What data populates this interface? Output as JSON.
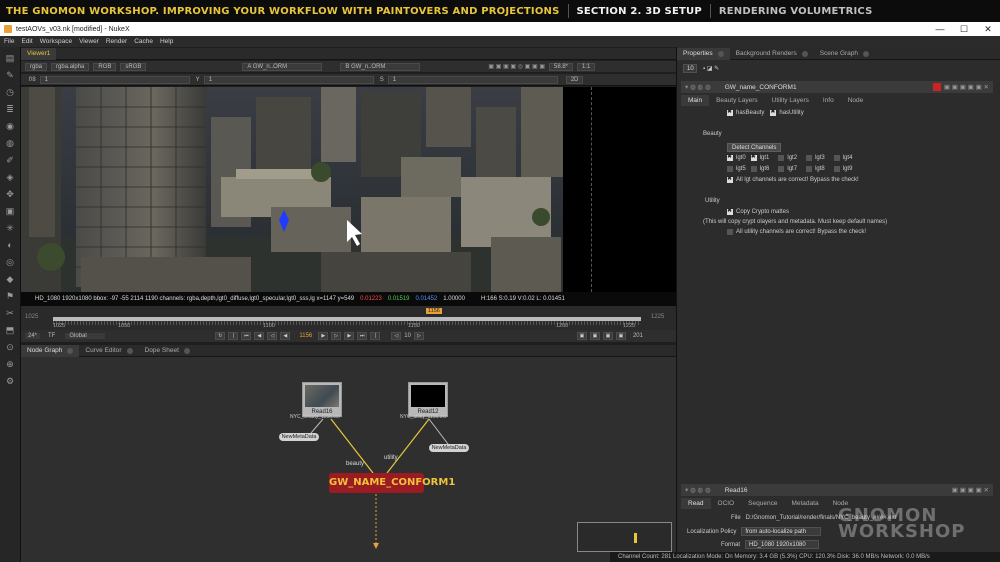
{
  "banner": {
    "part1": "THE GNOMON WORKSHOP. IMPROVING YOUR WORKFLOW WITH PAINTOVERS AND PROJECTIONS",
    "part2": "SECTION 2. 3D SETUP",
    "part3": "RENDERING VOLUMETRICS"
  },
  "window": {
    "title": "testAOVs_v03.nk [modified] - NukeX",
    "minimize": "—",
    "maximize": "☐",
    "close": "✕"
  },
  "menu": [
    "File",
    "Edit",
    "Workspace",
    "Viewer",
    "Render",
    "Cache",
    "Help"
  ],
  "viewer": {
    "tab": "Viewer1",
    "channels": "rgba",
    "alpha": "rgba.alpha",
    "colorspace_rgb": "RGB",
    "lut": "sRGB",
    "input_a": "A  GW_n..ORM",
    "input_b": "B  GW_n..ORM",
    "zoom": "58.8*",
    "ratio": "1:1",
    "fstop": "f/8",
    "frame1": "1",
    "y": "Y",
    "y_val": "1",
    "s": "S",
    "s_val": "1",
    "view2d": "2D",
    "info_left": "HD_1080 1920x1080  bbox: -97 -55 2114 1190 channels: rgba,depth,lgt0_diffuse,lgt0_specular,lgt0_sss,lg  x=1147 y=549",
    "info_r": "0.01223",
    "info_g": "0.01519",
    "info_b": "0.01452",
    "info_a": "1.00000",
    "info_hsv": "H:166 S:0.19 V:0.02  L: 0.01451"
  },
  "timeline": {
    "ticks": [
      "1025",
      "1050",
      "1100",
      "1150",
      "1200",
      "1225"
    ],
    "start": "1025",
    "end": "1225",
    "current": "1156",
    "marker": "1156",
    "fps": "24*",
    "tf": "TF",
    "global": "Global",
    "step": "10",
    "end_frame": "201"
  },
  "nodegraph": {
    "tabs": [
      "Node Graph",
      "Curve Editor",
      "Dope Sheet"
    ],
    "read16": {
      "label": "Read16",
      "file": "NYC_beauty_1156.exr"
    },
    "read12": {
      "label": "Read12",
      "file": "NYC_utility_1156.exr"
    },
    "meta1": "NewMetaData",
    "meta2": "NewMetaData",
    "input_beauty": "beauty",
    "input_utility": "utility",
    "conform": "GW_NAME_CONFORM1"
  },
  "properties": {
    "tabs": [
      "Properties",
      "Background Renders",
      "Scene Graph"
    ],
    "count": "10",
    "node_name": "GW_name_CONFORM1",
    "subtabs": [
      "Main",
      "Beauty Layers",
      "Utility Layers",
      "Info",
      "Node"
    ],
    "hasBeauty": "hasBeauty",
    "hasUtility": "hasUtility",
    "beauty_section": "Beauty",
    "detect_btn": "Detect Channels",
    "lgt_row1": [
      "lgt0",
      "lgt1",
      "lgt2",
      "lgt3",
      "lgt4"
    ],
    "lgt_row2": [
      "lgt5",
      "lgt6",
      "lgt7",
      "lgt8",
      "lgt9"
    ],
    "all_lgt": "All lgt channels are correct! Bypass the check!",
    "utility_section": "Utility",
    "copy_crypto": "Copy Crypto mattes",
    "crypto_note": "(This will copy crypt olayers and metadata. Must keep default names)",
    "all_util": "All utility channels are correct! Bypass the check!",
    "read_node": "Read16",
    "read_tabs": [
      "Read",
      "OCIO",
      "Sequence",
      "Metadata",
      "Node"
    ],
    "file_label": "File",
    "file_value": "D:/Gnomon_Tutorial/render/finals/NYC_beauty_####.exr",
    "localization_label": "Localization Policy",
    "localization_value": "from auto-localize path",
    "format_label": "Format",
    "format_value": "HD_1080 1920x1080"
  },
  "status": "Channel Count: 281  Localization Mode: On  Memory: 3.4 GB (5.3%)  CPU: 120.3%  Disk: 36.0 MB/s  Network: 0.0 MB/s",
  "watermark": [
    "GNOMON",
    "WORKSHOP"
  ],
  "colors": {
    "banner_yellow": "#e8c53a",
    "conform_red": "#9b1b23",
    "conform_text": "#f0c33a",
    "info_red": "#ff4a4a",
    "info_green": "#4cd34c",
    "info_blue": "#5a8cff"
  }
}
